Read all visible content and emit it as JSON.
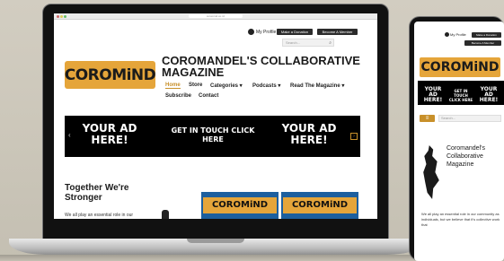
{
  "browser": {
    "url": "coromind.co.nz"
  },
  "laptop_site": {
    "top_bar": {
      "profile_label": "My Profile",
      "donate_label": "Make a Donation",
      "member_label": "Become A Member",
      "search_placeholder": "Search..."
    },
    "logo": {
      "text": "COROMiND"
    },
    "title": "COROMANDEL'S COLLABORATIVE MAGAZINE",
    "nav": {
      "items": [
        {
          "label": "Home"
        },
        {
          "label": "Store"
        },
        {
          "label": "Categories ▾"
        },
        {
          "label": "Podcasts ▾"
        },
        {
          "label": "Read The Magazine ▾"
        },
        {
          "label": "Subscribe"
        },
        {
          "label": "Contact"
        }
      ],
      "active_color": "#c8902a"
    },
    "banner": {
      "left": "YOUR AD HERE!",
      "middle": "GET IN TOUCH CLICK HERE",
      "right": "YOUR AD HERE!",
      "prev_arrow": "‹",
      "next_arrow": "›"
    },
    "tagline": "Together We're Stronger",
    "body_snippet": "We all play an essential role in our",
    "thumbnails": [
      {
        "text": "COROMiND"
      },
      {
        "text": "COROMiND"
      }
    ]
  },
  "phone_site": {
    "profile_label": "My Profile",
    "donate_label": "Make a Donation",
    "member_label": "Become A Member",
    "logo_text": "COROMiND",
    "banner": {
      "left": "YOUR AD HERE!",
      "middle": "GET IN TOUCH CLICK HERE",
      "right": "YOUR AD HERE!"
    },
    "menu_icon": "≡",
    "search_placeholder": "Search...",
    "title": "Coromandel's Collaborative Magazine",
    "body_text": "We all play an essential role in our community as individuals, but we believe that it's collective work that"
  },
  "colors": {
    "accent": "#c8902a",
    "logo_bg": "#e5a53a",
    "dark_button": "#2b2b2b"
  },
  "icons": [
    "user-icon",
    "search-icon",
    "chevron-left-icon",
    "chevron-right-icon",
    "hamburger-icon"
  ]
}
